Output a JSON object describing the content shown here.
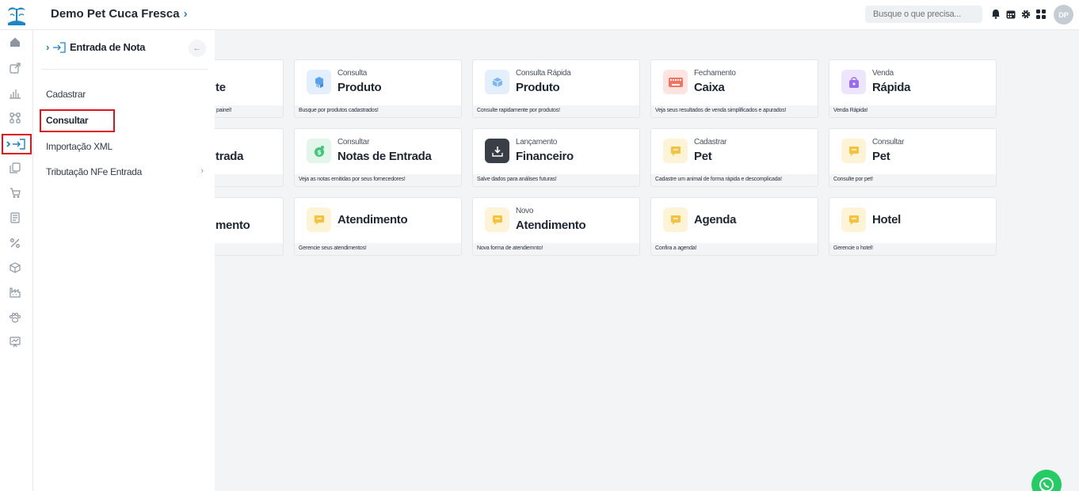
{
  "header": {
    "company_name": "Demo Pet Cuca Fresca",
    "search_placeholder": "Busque o que precisa...",
    "avatar_initials": "DP",
    "icons": [
      "bell-icon",
      "calendar-icon",
      "settings-icon",
      "apps-grid-icon"
    ]
  },
  "rail": {
    "items": [
      "home-icon",
      "external-link-icon",
      "bar-chart-icon",
      "connections-icon",
      "entrada-nota-icon",
      "documents-icon",
      "cart-icon",
      "receipt-icon",
      "percent-icon",
      "box-icon",
      "factory-icon",
      "paw-icon",
      "presentation-icon"
    ],
    "active_index": 4
  },
  "panel": {
    "title": "Entrada de Nota",
    "items": [
      {
        "label": "Cadastrar"
      },
      {
        "label": "Consultar",
        "selected": true
      },
      {
        "label": "Importação XML"
      },
      {
        "label": "Tributação NFe Entrada",
        "has_submenu": true
      }
    ]
  },
  "cards": [
    {
      "sub": "",
      "title": "te",
      "desc": "painel!",
      "icon": "hidden",
      "color": ""
    },
    {
      "sub": "Consulta",
      "title": "Produto",
      "desc": "Busque por produtos cadastrados!",
      "icon": "cubes-icon",
      "color": "#e3effd"
    },
    {
      "sub": "Consulta Rápida",
      "title": "Produto",
      "desc": "Consulte rapidamente por produtos!",
      "icon": "cube-icon",
      "color": "#e3effd"
    },
    {
      "sub": "Fechamento",
      "title": "Caixa",
      "desc": "Veja seus resultados de venda simplificados e apurados!",
      "icon": "keyboard-icon",
      "color": "#fde4e1"
    },
    {
      "sub": "Venda",
      "title": "Rápida",
      "desc": "Venda Rápida!",
      "icon": "shopping-bag-icon",
      "color": "#ece5fb"
    },
    {
      "sub": "",
      "title": "trada",
      "desc": "",
      "icon": "hidden",
      "color": ""
    },
    {
      "sub": "Consultar",
      "title": "Notas de Entrada",
      "desc": "Veja as notas emitidas por seus fornecedores!",
      "icon": "money-icon",
      "color": "#e2f6e9"
    },
    {
      "sub": "Lançamento",
      "title": "Financeiro",
      "desc": "Salve dados para análises futuras!",
      "icon": "download-icon",
      "color": "#e5e7ea"
    },
    {
      "sub": "Cadastrar",
      "title": "Pet",
      "desc": "Cadastre um animal de forma rápida e descomplicada!",
      "icon": "chat-icon",
      "color": "#fdf3d6"
    },
    {
      "sub": "Consultar",
      "title": "Pet",
      "desc": "Consulte por pet!",
      "icon": "chat-icon",
      "color": "#fdf3d6"
    },
    {
      "sub": "",
      "title": "mento",
      "desc": "",
      "icon": "hidden",
      "color": ""
    },
    {
      "sub": "",
      "title": "Atendimento",
      "desc": "Gerencie seus atendimentos!",
      "icon": "chat-icon",
      "color": "#fdf3d6"
    },
    {
      "sub": "Novo",
      "title": "Atendimento",
      "desc": "Nova forma de atendiemnto!",
      "icon": "chat-icon",
      "color": "#fdf3d6"
    },
    {
      "sub": "",
      "title": "Agenda",
      "desc": "Confira a agenda!",
      "icon": "chat-icon",
      "color": "#fdf3d6"
    },
    {
      "sub": "",
      "title": "Hotel",
      "desc": "Gerencie o hotel!",
      "icon": "chat-icon",
      "color": "#fdf3d6"
    }
  ],
  "colors": {
    "accent": "#1b86c6",
    "highlight": "#e0141f",
    "whatsapp": "#25cc64"
  }
}
